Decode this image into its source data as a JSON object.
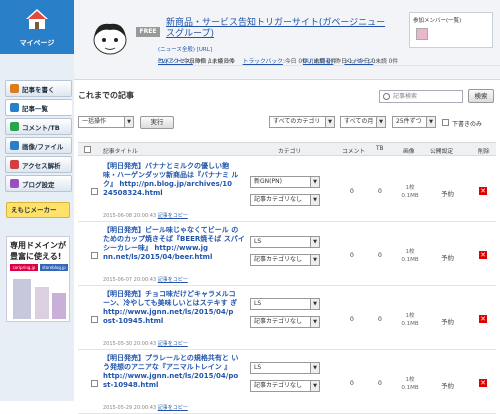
{
  "sidebar": {
    "mypage_label": "マイページ",
    "items": [
      {
        "label": "記事を書く",
        "icon": "pencil-icon",
        "color": "#e07b1a"
      },
      {
        "label": "記事一覧",
        "icon": "list-icon",
        "color": "#2a7fc9"
      },
      {
        "label": "コメント/TB",
        "icon": "comment-icon",
        "color": "#2aa44a"
      },
      {
        "label": "画像/ファイル",
        "icon": "image-icon",
        "color": "#2a7fc9"
      },
      {
        "label": "アクセス解析",
        "icon": "chart-icon",
        "color": "#d04040"
      },
      {
        "label": "ブログ設定",
        "icon": "wrench-icon",
        "color": "#9a4fc0"
      }
    ],
    "emoji_label": "えもじメーカー",
    "ad": {
      "line1": "専用ドメインが",
      "line2": "豊富に使える!",
      "domain1": "coripring.jp",
      "domain2": "storeblog.jp"
    }
  },
  "header": {
    "free_badge": "FREE",
    "blog_title": "新商品・サービス告知トリガーサイト(ガページニュースグループ)",
    "links": "(ニュース全般) [URL]",
    "stats": {
      "pv_label": "PV(アクセス)",
      "pv_value": ":昨日 1 / 今日 0",
      "uu_label": "UU(訪問者)",
      "uu_value": ":昨日 1 / 今日 0",
      "comment_label": "コメント",
      "comment_value": ":今日 0件 / 未読 0件",
      "trackback_label": "トラックバック",
      "trackback_value": ":今日 0件 / 未読 0件",
      "message_label": "メッセージ",
      "message_value": ":未読 0件"
    },
    "members_title": "参加メンバー(一覧)"
  },
  "main": {
    "section_title": "これまでの記事",
    "search_placeholder": "記事検索",
    "search_button": "検索",
    "bulk_select": "一括操作",
    "execute_button": "実行",
    "filter_category": "すべてのカテゴリ",
    "filter_month": "すべての月",
    "filter_count": "25件ずつ",
    "draft_label": "下書きのみ",
    "columns": {
      "title": "記事タイトル",
      "category": "カテゴリ",
      "comment": "コメント",
      "tb": "TB",
      "image": "画像",
      "status": "公開設定",
      "delete": "削除"
    },
    "articles": [
      {
        "title": "【明日発売】バナナとミルクの優しい飽 味・ハーゲンダッツ新商品は『バナナミ ルク』 http://pn.blog.jp/archives/10 24508324.html",
        "date": "2015-06-08 20:00:43",
        "copy": "記事をコピー",
        "category1": "新GN(PN)",
        "category2": "記事カテゴリなし",
        "comment": "0",
        "tb": "0",
        "image": "1枚 0.1MB",
        "status": "予約"
      },
      {
        "title": "【明日発売】ビール味じゃなくてビール のためのカップ焼きそば『BEER焼そば スパイシーカレー味』 http://www.jg nn.net/ls/2015/04/beer.html",
        "date": "2015-06-07 20:00:43",
        "copy": "記事をコピー",
        "category1": "LS",
        "category2": "記事カテゴリなし",
        "comment": "0",
        "tb": "0",
        "image": "1枚 0.1MB",
        "status": "予約"
      },
      {
        "title": "【明日発売】チョコ味だけどキャラメルコ ーン、冷やしても美味しいとはステキす ぎ http://www.jgnn.net/ls/2015/04/p ost-10945.html",
        "date": "2015-05-30 20:00:43",
        "copy": "記事をコピー",
        "category1": "LS",
        "category2": "記事カテゴリなし",
        "comment": "0",
        "tb": "0",
        "image": "1枚 0.1MB",
        "status": "予約"
      },
      {
        "title": "【明日発売】プラレールとの規格共有と いう発想のアニアな『アニマルトレイン 』 http://www.jgnn.net/ls/2015/04/po st-10948.html",
        "date": "2015-05-29 20:00:43",
        "copy": "記事をコピー",
        "category1": "LS",
        "category2": "記事カテゴリなし",
        "comment": "0",
        "tb": "0",
        "image": "1枚 0.1MB",
        "status": "予約"
      }
    ]
  }
}
